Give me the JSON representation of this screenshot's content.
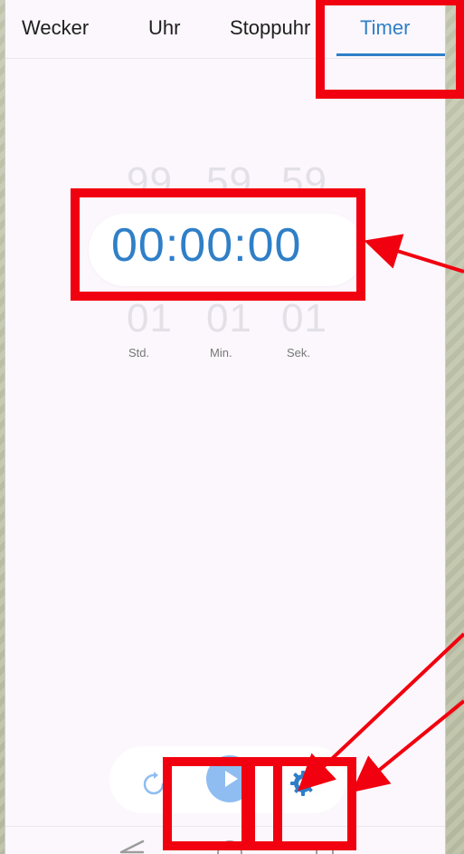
{
  "tabs": [
    {
      "label": "Wecker"
    },
    {
      "label": "Uhr"
    },
    {
      "label": "Stoppuhr"
    },
    {
      "label": "Timer",
      "active": true
    }
  ],
  "picker": {
    "above": {
      "hours": "99",
      "minutes": "59",
      "seconds": "59"
    },
    "current": "00:00:00",
    "below": {
      "hours": "01",
      "minutes": "01",
      "seconds": "01"
    },
    "units": {
      "hours": "Std.",
      "minutes": "Min.",
      "seconds": "Sek."
    }
  },
  "controls": {
    "reset_icon": "reset-icon",
    "play_icon": "play-icon",
    "settings_icon": "gear-icon"
  },
  "colors": {
    "accent": "#2f7fc8",
    "play_bg": "#8fbdf1",
    "annotation": "#f1000f"
  },
  "navigation": [
    "back-icon",
    "home-icon",
    "recent-apps-icon"
  ]
}
